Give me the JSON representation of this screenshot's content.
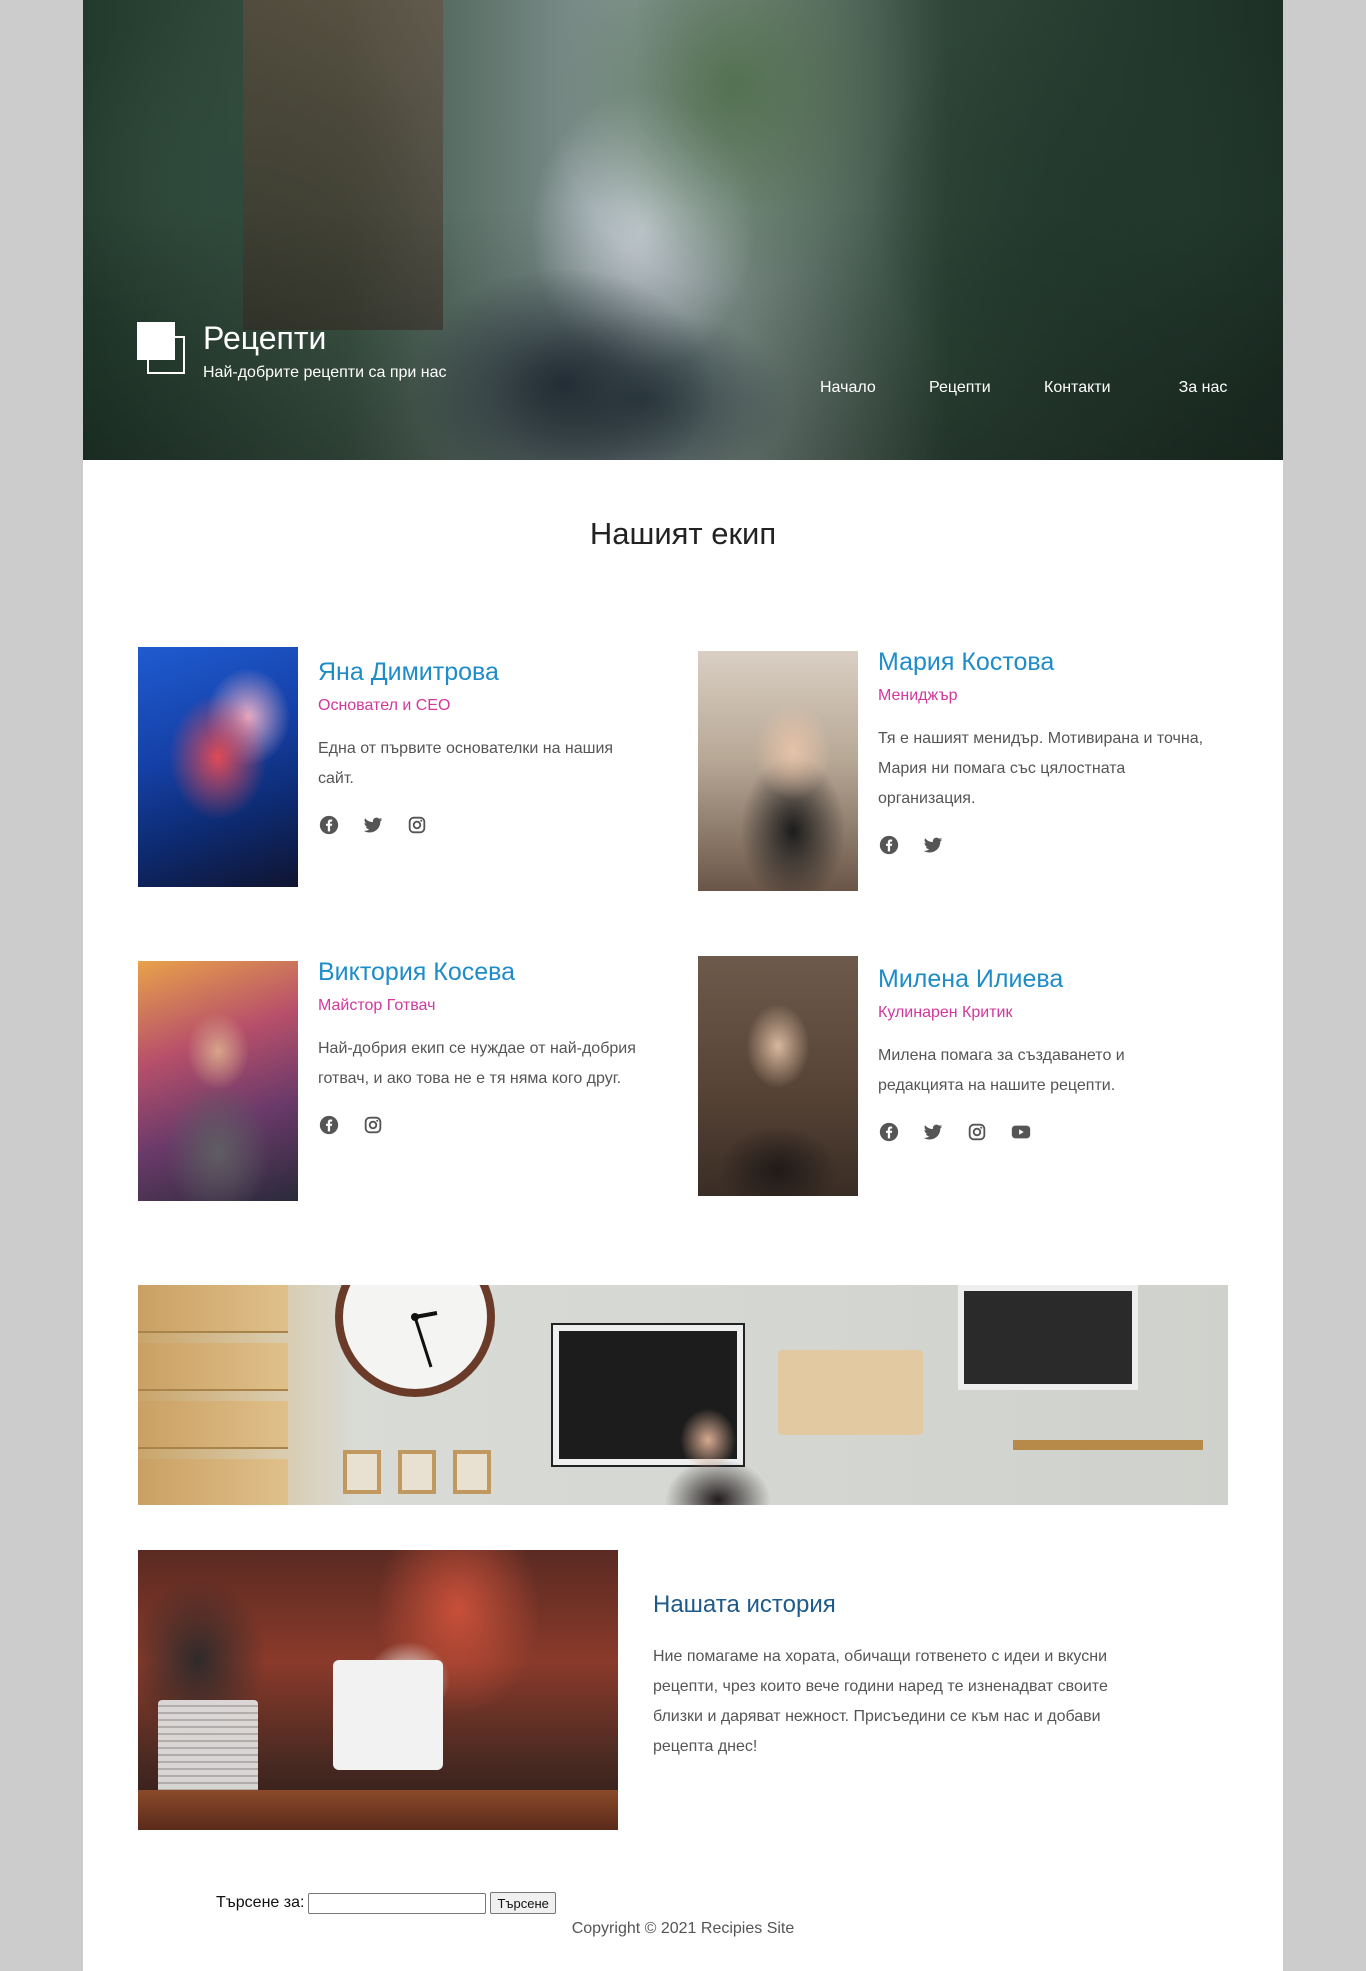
{
  "header": {
    "title": "Рецепти",
    "tagline": "Най-добрите рецепти са при нас",
    "nav": [
      "Начало",
      "Рецепти",
      "Контакти",
      "За нас"
    ]
  },
  "team": {
    "title": "Нашият екип",
    "members": [
      {
        "name": "Яна Димитрова",
        "role": "Основател и CEO",
        "bio": "Една от първите основателки на нашия сайт.",
        "socials": [
          "facebook-icon",
          "twitter-icon",
          "instagram-icon"
        ]
      },
      {
        "name": "Мария Костова",
        "role": "Мениджър",
        "bio": "Тя е нашият менидър. Мотивирана и точна, Мария ни помага със цялостната организация.",
        "socials": [
          "facebook-icon",
          "twitter-icon"
        ]
      },
      {
        "name": "Виктория Косева",
        "role": "Майстор Готвач",
        "bio": "Най-добрия екип се нуждае от най-добрия готвач, и ако това не е тя няма кого друг.",
        "socials": [
          "facebook-icon",
          "instagram-icon"
        ]
      },
      {
        "name": "Милена Илиева",
        "role": "Кулинарен Критик",
        "bio": "Милена помага за създаването и редакцията на нашите рецепти.",
        "socials": [
          "facebook-icon",
          "twitter-icon",
          "instagram-icon",
          "youtube-icon"
        ]
      }
    ]
  },
  "story": {
    "title": "Нашата история",
    "text": "Ние помагаме на хората, обичащи готвенето с идеи и вкусни рецепти, чрез които вече години наред те изненадват своите близки и даряват нежност. Присъедини се към нас и добави рецепта днес!"
  },
  "footer": {
    "search_label": "Търсене за:",
    "search_value": "",
    "search_button": "Търсене",
    "copyright": "Copyright © 2021 Recipies Site"
  },
  "colors": {
    "name": "#1e8cc8",
    "role": "#d0389c",
    "story_title": "#1e5a8a",
    "background": "#cccccc"
  }
}
